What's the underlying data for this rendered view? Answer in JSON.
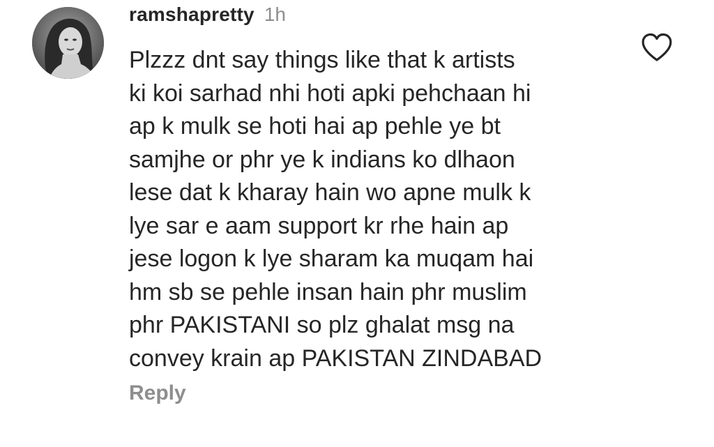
{
  "comment": {
    "username": "ramshapretty",
    "timestamp": "1h",
    "lines": [
      "Plzzz dnt say things like that k artists",
      "ki koi sarhad nhi hoti apki pehchaan hi",
      "ap k mulk se hoti hai ap pehle ye bt",
      "samjhe or phr ye k indians ko dlhaon",
      "lese dat k kharay hain wo apne mulk k",
      "lye sar e aam support kr rhe hain ap",
      "jese logon k lye sharam ka muqam hai",
      "hm sb se pehle insan hain phr muslim",
      "phr PAKISTANI so plz ghalat msg na",
      "convey krain ap PAKISTAN ZINDABAD"
    ],
    "reply_label": "Reply",
    "like_icon": "heart-outline-icon",
    "avatar_icon": "profile-photo"
  },
  "colors": {
    "primary_text": "#262626",
    "secondary_text": "#8e8e8e",
    "background": "#ffffff"
  }
}
